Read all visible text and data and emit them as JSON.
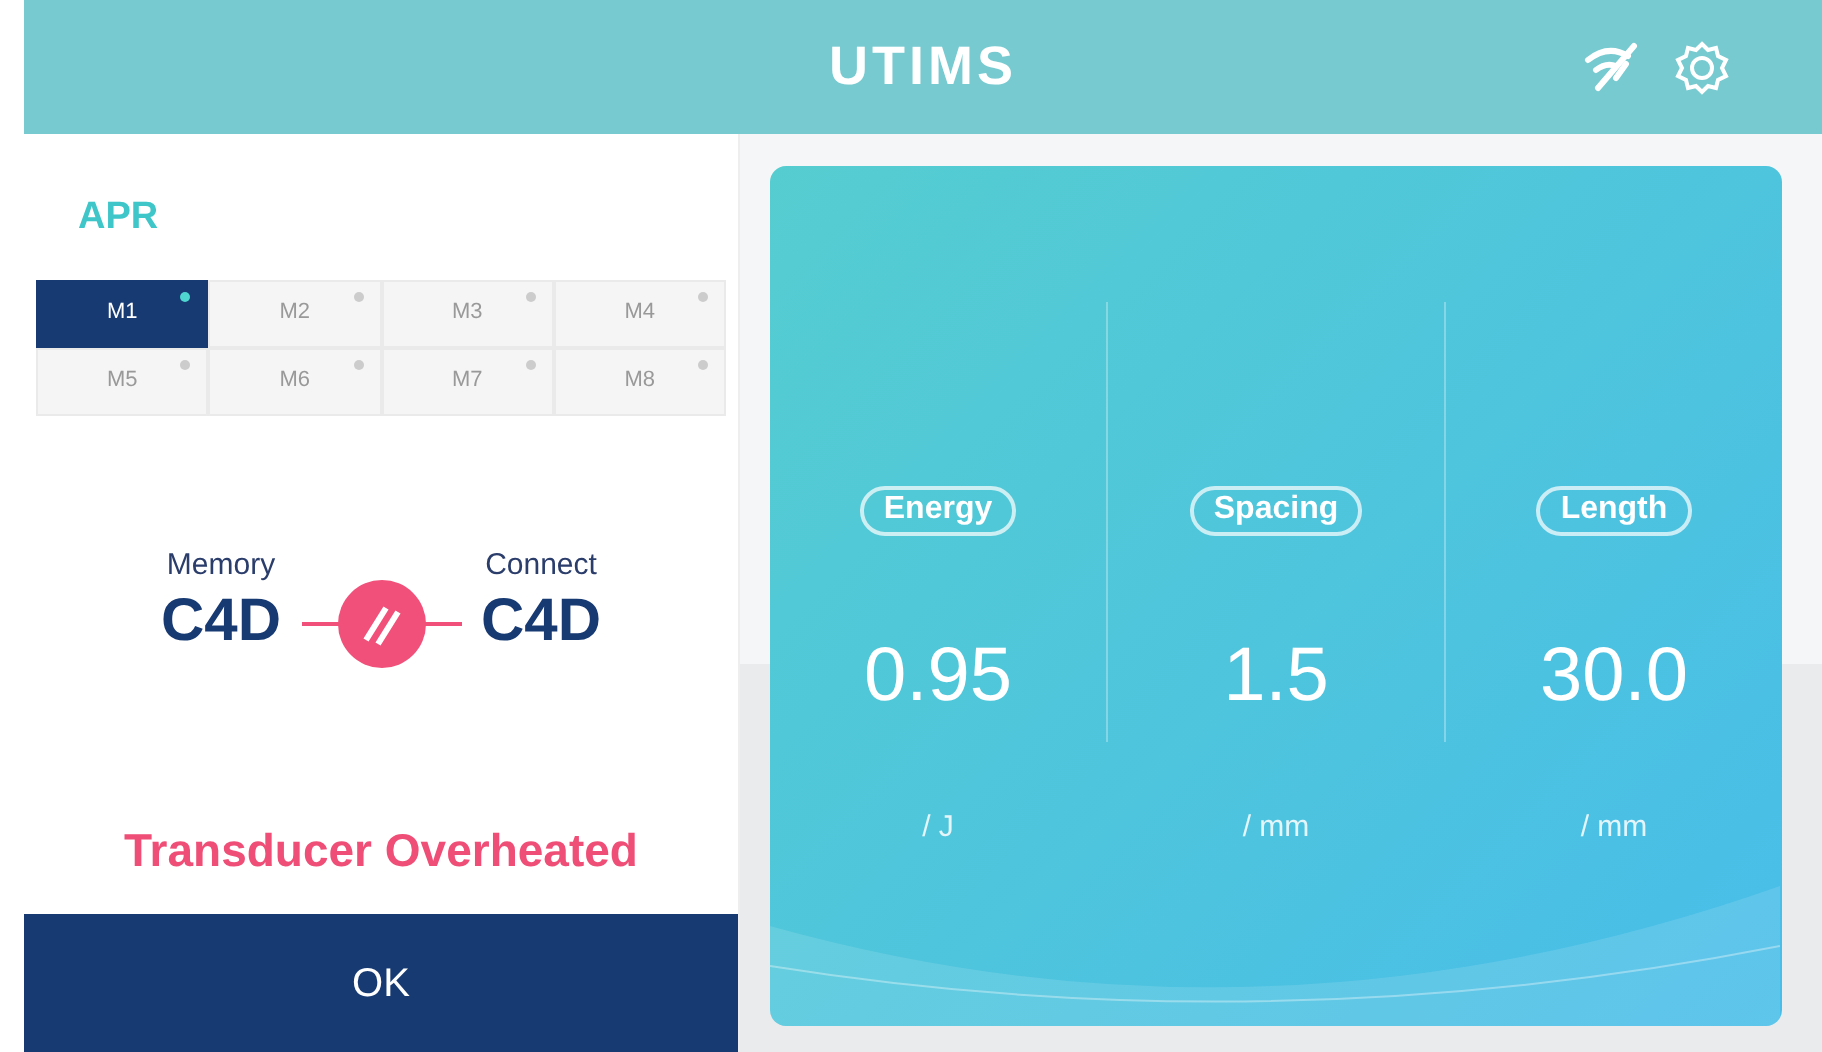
{
  "header": {
    "title": "UTIMS"
  },
  "mode": {
    "label": "APR"
  },
  "memories": [
    {
      "label": "M1",
      "selected": true
    },
    {
      "label": "M2",
      "selected": false
    },
    {
      "label": "M3",
      "selected": false
    },
    {
      "label": "M4",
      "selected": false
    },
    {
      "label": "M5",
      "selected": false
    },
    {
      "label": "M6",
      "selected": false
    },
    {
      "label": "M7",
      "selected": false
    },
    {
      "label": "M8",
      "selected": false
    }
  ],
  "link": {
    "memory_label": "Memory",
    "memory_value": "C4D",
    "connect_label": "Connect",
    "connect_value": "C4D",
    "connected": false
  },
  "warning": "Transducer Overheated",
  "ok_button": "OK",
  "parameters": [
    {
      "name": "Energy",
      "value": "0.95",
      "unit": "/ J"
    },
    {
      "name": "Spacing",
      "value": "1.5",
      "unit": "/ mm"
    },
    {
      "name": "Length",
      "value": "30.0",
      "unit": "/ mm"
    }
  ]
}
